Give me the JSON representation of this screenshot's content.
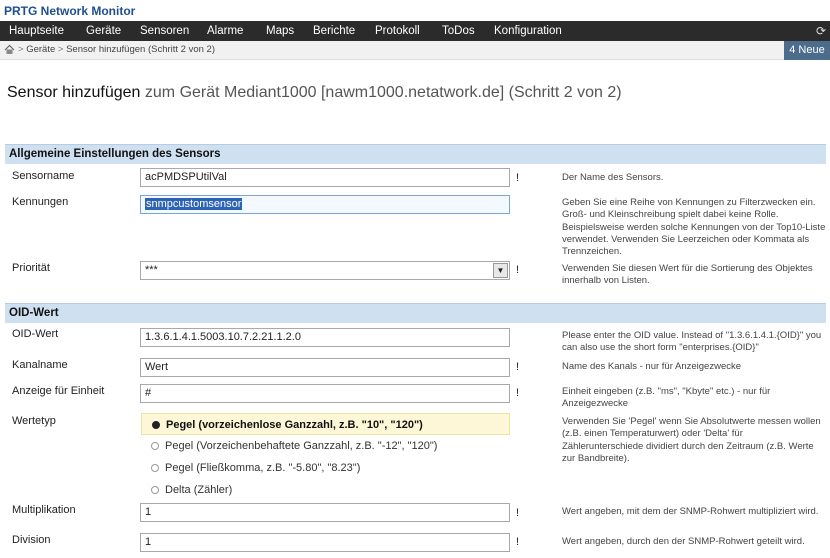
{
  "app": {
    "title": "PRTG Network Monitor"
  },
  "nav": {
    "items": [
      "Hauptseite",
      "Geräte",
      "Sensoren",
      "Alarme",
      "Maps",
      "Berichte",
      "Protokoll",
      "ToDos",
      "Konfiguration"
    ]
  },
  "breadcrumb": {
    "parent": "Geräte",
    "separator": ">",
    "current": "Sensor hinzufügen (Schritt 2 von 2)"
  },
  "badge": {
    "label": "4 Neue"
  },
  "page": {
    "title_main": "Sensor hinzufügen",
    "title_sub": "zum Gerät Mediant1000 [nawm1000.netatwork.de] (Schritt 2 von 2)"
  },
  "sections": {
    "general": "Allgemeine Einstellungen des Sensors",
    "oid": "OID-Wert"
  },
  "fields": {
    "sensorname": {
      "label": "Sensorname",
      "value": "acPMDSPUtilVal",
      "required": "!",
      "help": "Der Name des Sensors."
    },
    "kennungen": {
      "label": "Kennungen",
      "value": "snmpcustomsensor",
      "help": "Geben Sie eine Reihe von Kennungen zu Filterzwecken ein. Groß- und Kleinschreibung spielt dabei keine Rolle. Beispielsweise werden solche Kennungen von der Top10-Liste verwendet. Verwenden Sie Leerzeichen oder Kommata als Trennzeichen."
    },
    "prioritaet": {
      "label": "Priorität",
      "value": "***",
      "required": "!",
      "help": "Verwenden Sie diesen Wert für die Sortierung des Objektes innerhalb von Listen."
    },
    "oid": {
      "label": "OID-Wert",
      "value": "1.3.6.1.4.1.5003.10.7.2.21.1.2.0",
      "help": "Please enter the OID value. Instead of \"1.3.6.1.4.1.{OID}\" you can also use the short form \"enterprises.{OID}\""
    },
    "kanalname": {
      "label": "Kanalname",
      "value": "Wert",
      "required": "!",
      "help": "Name des Kanals - nur für Anzeigezwecke"
    },
    "einheit": {
      "label": "Anzeige für Einheit",
      "value": "#",
      "required": "!",
      "help": "Einheit eingeben (z.B. \"ms\", \"Kbyte\" etc.) - nur für Anzeigezwecke"
    },
    "wertetyp": {
      "label": "Wertetyp",
      "options": [
        "Pegel (vorzeichenlose Ganzzahl, z.B. \"10\", \"120\")",
        "Pegel (Vorzeichenbehaftete Ganzzahl, z.B. \"-12\", \"120\")",
        "Pegel (Fließkomma, z.B. \"-5.80\", \"8.23\")",
        "Delta (Zähler)"
      ],
      "selected": "Pegel (vorzeichenlose Ganzzahl, z.B. \"10\", \"120\")",
      "help": "Verwenden Sie 'Pegel' wenn Sie Absolutwerte messen wollen (z.B. einen Temperaturwert) oder 'Delta' für Zählerunterschiede dividiert durch den Zeitraum (z.B. Werte zur Bandbreite)."
    },
    "multiplikation": {
      "label": "Multiplikation",
      "value": "1",
      "required": "!",
      "help": "Wert angeben, mit dem der SNMP-Rohwert multipliziert wird."
    },
    "division": {
      "label": "Division",
      "value": "1",
      "required": "!",
      "help": "Wert angeben, durch den der SNMP-Rohwert geteilt wird."
    }
  },
  "icons": {
    "home": "home-icon",
    "refresh": "refresh-icon",
    "dropdown": "chevron-down-icon",
    "radio": "radio-icon"
  },
  "colors": {
    "nav_bg": "#2b2b2b",
    "section_bg": "#cfe0f1",
    "badge_bg": "#4c6c8c",
    "title_blue": "#1f4f8f",
    "selected_option_bg": "#fdf6d7"
  }
}
